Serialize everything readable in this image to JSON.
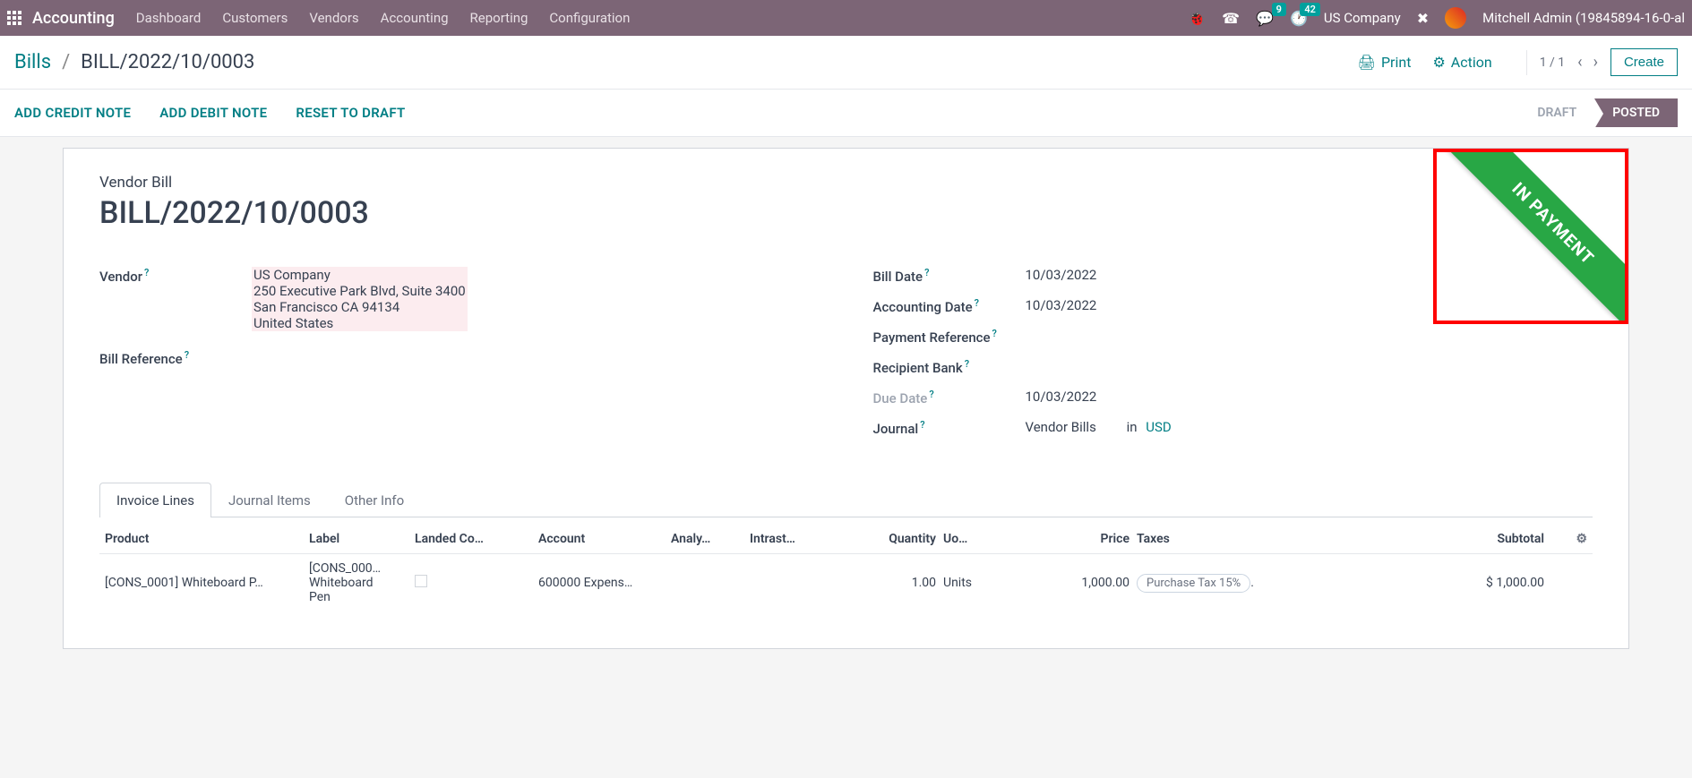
{
  "nav": {
    "brand": "Accounting",
    "items": [
      "Dashboard",
      "Customers",
      "Vendors",
      "Accounting",
      "Reporting",
      "Configuration"
    ],
    "msg_badge": "9",
    "activity_badge": "42",
    "company": "US Company",
    "user": "Mitchell Admin (19845894-16-0-al"
  },
  "crumb": {
    "root": "Bills",
    "current": "BILL/2022/10/0003"
  },
  "tools": {
    "print": "Print",
    "action": "Action",
    "pager": "1 / 1",
    "create": "Create"
  },
  "actions": {
    "credit": "ADD CREDIT NOTE",
    "debit": "ADD DEBIT NOTE",
    "reset": "RESET TO DRAFT",
    "draft": "DRAFT",
    "posted": "POSTED"
  },
  "ribbon": "IN PAYMENT",
  "doc": {
    "type": "Vendor Bill",
    "title": "BILL/2022/10/0003"
  },
  "left": {
    "vendor_label": "Vendor",
    "vendor_name": "US Company",
    "vendor_addr1": "250 Executive Park Blvd, Suite 3400",
    "vendor_addr2": "San Francisco CA 94134",
    "vendor_addr3": "United States",
    "billref_label": "Bill Reference"
  },
  "right": {
    "billdate_label": "Bill Date",
    "billdate": "10/03/2022",
    "accdate_label": "Accounting Date",
    "accdate": "10/03/2022",
    "payref_label": "Payment Reference",
    "bank_label": "Recipient Bank",
    "duedate_label": "Due Date",
    "duedate": "10/03/2022",
    "journal_label": "Journal",
    "journal": "Vendor Bills",
    "in": "in",
    "currency": "USD"
  },
  "tabs": {
    "t1": "Invoice Lines",
    "t2": "Journal Items",
    "t3": "Other Info"
  },
  "grid": {
    "h_product": "Product",
    "h_label": "Label",
    "h_landed": "Landed Co…",
    "h_account": "Account",
    "h_analy": "Analy…",
    "h_intrast": "Intrast…",
    "h_qty": "Quantity",
    "h_uom": "Uo…",
    "h_price": "Price",
    "h_taxes": "Taxes",
    "h_subtotal": "Subtotal",
    "r_product": "[CONS_0001] Whiteboard P…",
    "r_label1": "[CONS_000…",
    "r_label2": "Whiteboard",
    "r_label3": "Pen",
    "r_account": "600000 Expens…",
    "r_qty": "1.00",
    "r_uom": "Units",
    "r_price": "1,000.00",
    "r_tax": "Purchase Tax 15%",
    "r_tax_suffix": ".",
    "r_subtotal": "$ 1,000.00"
  }
}
